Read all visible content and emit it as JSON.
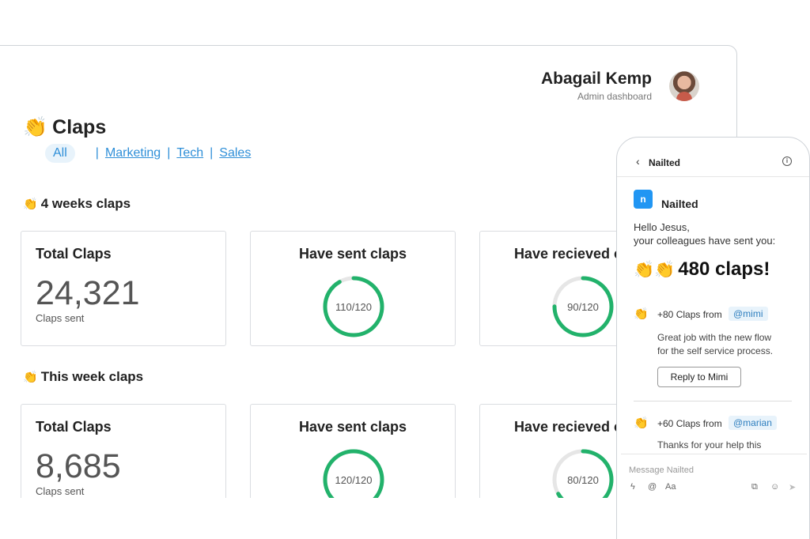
{
  "user": {
    "name": "Abagail Kemp",
    "role": "Admin dashboard"
  },
  "page": {
    "emoji": "👏",
    "title": "Claps"
  },
  "filters": {
    "active": "All",
    "links": [
      "Marketing",
      "Tech",
      "Sales"
    ],
    "separator": "|"
  },
  "sections": [
    {
      "title": "4 weeks claps",
      "total": {
        "title": "Total Claps",
        "value": "24,321",
        "label": "Claps sent"
      },
      "sent": {
        "title": "Have sent claps",
        "text": "110/120",
        "value": 110,
        "max": 120
      },
      "received": {
        "title": "Have recieved claps",
        "text": "90/120",
        "value": 90,
        "max": 120
      }
    },
    {
      "title": "This week claps",
      "total": {
        "title": "Total Claps",
        "value": "8,685",
        "label": "Claps sent"
      },
      "sent": {
        "title": "Have sent claps",
        "text": "120/120",
        "value": 120,
        "max": 120
      },
      "received": {
        "title": "Have recieved claps",
        "text": "80/120",
        "value": 80,
        "max": 120
      }
    }
  ],
  "chat": {
    "back": "‹",
    "header": "Nailted",
    "info": "i",
    "app_logo": "n",
    "app_name": "Nailted",
    "greeting_line1": "Hello Jesus,",
    "greeting_line2": "your colleagues have sent you:",
    "total_emoji": "👏👏",
    "total": "480 claps!",
    "messages": [
      {
        "emoji": "👏",
        "from": "+80 Claps from",
        "mention": "@mimi",
        "body1": "Great job with the new flow",
        "body2": "for the  self service process.",
        "reply": "Reply to Mimi"
      },
      {
        "emoji": "👏",
        "from": "+60 Claps from",
        "mention": "@marian",
        "body1": "Thanks for your help this"
      }
    ],
    "composer_placeholder": "Message Nailted",
    "tools": {
      "bolt": "ϟ",
      "at": "@",
      "format": "Aa",
      "attach": "⧉",
      "emoji": "☺",
      "send": "➤"
    }
  },
  "colors": {
    "accent": "#2f8fd8",
    "ring_fill": "#22b26b",
    "ring_track": "#e6e6e6",
    "app_blue": "#2196f3"
  }
}
